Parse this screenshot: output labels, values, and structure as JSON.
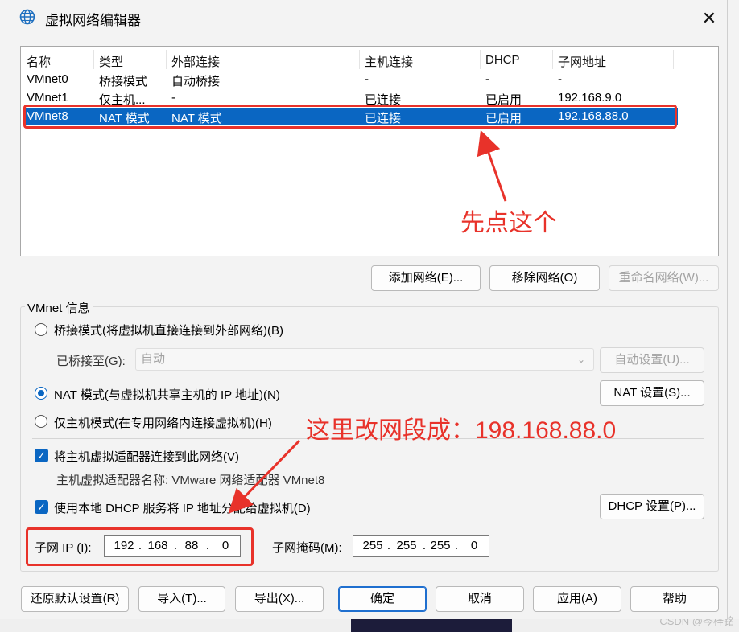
{
  "window": {
    "title": "虚拟网络编辑器",
    "close_glyph": "✕"
  },
  "network_list": {
    "columns": [
      "名称",
      "类型",
      "外部连接",
      "主机连接",
      "DHCP",
      "子网地址"
    ],
    "rows": [
      [
        "VMnet0",
        "桥接模式",
        "自动桥接",
        "-",
        "-",
        "-"
      ],
      [
        "VMnet1",
        "仅主机...",
        "-",
        "已连接",
        "已启用",
        "192.168.9.0"
      ],
      [
        "VMnet8",
        "NAT 模式",
        "NAT 模式",
        "已连接",
        "已启用",
        "192.168.88.0"
      ]
    ],
    "selected_row": 2
  },
  "annotations": {
    "click_first": "先点这个",
    "change_subnet": "这里改网段成：198.168.88.0",
    "color": "#e8322a"
  },
  "list_buttons": {
    "add": "添加网络(E)...",
    "remove": "移除网络(O)",
    "rename": "重命名网络(W)..."
  },
  "info": {
    "legend": "VMnet 信息",
    "bridged_radio": "桥接模式(将虚拟机直接连接到外部网络)(B)",
    "bridged_to_label": "已桥接至(G):",
    "bridged_to_value": "自动",
    "auto_settings": "自动设置(U)...",
    "nat_radio": "NAT 模式(与虚拟机共享主机的 IP 地址)(N)",
    "nat_settings": "NAT 设置(S)...",
    "hostonly_radio": "仅主机模式(在专用网络内连接虚拟机)(H)",
    "connect_adapter_check": "将主机虚拟适配器连接到此网络(V)",
    "adapter_name": "主机虚拟适配器名称: VMware 网络适配器 VMnet8",
    "dhcp_check": "使用本地 DHCP 服务将 IP 地址分配给虚拟机(D)",
    "dhcp_settings": "DHCP 设置(P)...",
    "subnet_ip_label": "子网 IP (I):",
    "subnet_ip": [
      "192",
      "168",
      "88",
      "0"
    ],
    "subnet_mask_label": "子网掩码(M):",
    "subnet_mask": [
      "255",
      "255",
      "255",
      "0"
    ],
    "selected_mode": "nat"
  },
  "bottom_buttons": {
    "restore": "还原默认设置(R)",
    "import": "导入(T)...",
    "export": "导出(X)...",
    "ok": "确定",
    "cancel": "取消",
    "apply": "应用(A)",
    "help": "帮助"
  },
  "watermark": "CSDN @岑梓铭",
  "colors": {
    "accent": "#0a66c2",
    "annotation": "#e8322a"
  }
}
